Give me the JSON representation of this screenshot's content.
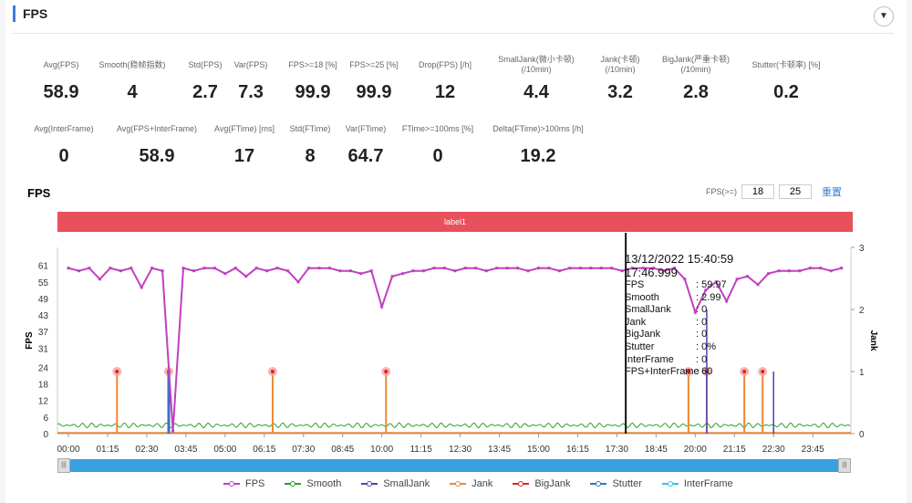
{
  "header": {
    "title": "FPS",
    "collapse_icon": "chevron-down-icon"
  },
  "stats_row1": [
    {
      "label": "Avg(FPS)",
      "value": "58.9",
      "help": false
    },
    {
      "label": "Smooth(稳帧指数)",
      "value": "4",
      "help": true
    },
    {
      "label": "Std(FPS)",
      "value": "2.7",
      "help": false
    },
    {
      "label": "Var(FPS)",
      "value": "7.3",
      "help": false
    },
    {
      "label": "FPS>=18 [%]",
      "value": "99.9",
      "help": false
    },
    {
      "label": "FPS>=25 [%]",
      "value": "99.9",
      "help": false
    },
    {
      "label": "Drop(FPS) [/h]",
      "value": "12",
      "help": true
    },
    {
      "label": "SmallJank(微小卡顿)",
      "label2": "(/10min)",
      "value": "4.4",
      "help": true
    },
    {
      "label": "Jank(卡顿)",
      "label2": "(/10min)",
      "value": "3.2",
      "help": true
    },
    {
      "label": "BigJank(严重卡顿)",
      "label2": "(/10min)",
      "value": "2.8",
      "help": true
    },
    {
      "label": "Stutter(卡顿率) [%]",
      "value": "0.2",
      "help": false
    }
  ],
  "stats_row2": [
    {
      "label": "Avg(InterFrame)",
      "value": "0",
      "help": false
    },
    {
      "label": "Avg(FPS+InterFrame)",
      "value": "58.9",
      "help": false
    },
    {
      "label": "Avg(FTime) [ms]",
      "value": "17",
      "help": false
    },
    {
      "label": "Std(FTime)",
      "value": "8",
      "help": false
    },
    {
      "label": "Var(FTime)",
      "value": "64.7",
      "help": false
    },
    {
      "label": "FTime>=100ms [%]",
      "value": "0",
      "help": false
    },
    {
      "label": "Delta(FTime)>100ms [/h]",
      "value": "19.2",
      "help": true
    }
  ],
  "chart_section": {
    "title": "FPS",
    "filter_label": "FPS(>=)",
    "filter_values": [
      "18",
      "25"
    ],
    "reset_label": "重置",
    "label_bar": "label1"
  },
  "tooltip": {
    "timestamp": "13/12/2022 15:40:59",
    "time": "17:46.999",
    "rows": [
      [
        "FPS",
        ": 59.97"
      ],
      [
        "Smooth",
        ": 2.99"
      ],
      [
        "SmallJank",
        ": 0"
      ],
      [
        "Jank",
        ": 0"
      ],
      [
        "BigJank",
        ": 0"
      ],
      [
        "Stutter",
        ": 0%"
      ],
      [
        "InterFrame",
        ": 0"
      ],
      [
        "FPS+InterFrame",
        ": 60"
      ]
    ]
  },
  "chart_data": {
    "type": "line",
    "xlabel": "",
    "ylabel": "FPS",
    "y2label": "Jank",
    "x_ticks": [
      "00:00",
      "01:15",
      "02:30",
      "03:45",
      "05:00",
      "06:15",
      "07:30",
      "08:45",
      "10:00",
      "11:15",
      "12:30",
      "13:45",
      "15:00",
      "16:15",
      "17:30",
      "18:45",
      "20:00",
      "21:15",
      "22:30",
      "23:45"
    ],
    "y_ticks": [
      0,
      6,
      12,
      18,
      24,
      31,
      37,
      43,
      49,
      55,
      61
    ],
    "y2_ticks": [
      0,
      1,
      2,
      3
    ],
    "ylim": [
      0,
      67.5
    ],
    "y2lim": [
      0,
      3
    ],
    "xlim_seconds": [
      -21,
      1498
    ],
    "fps_sample_interval_s": 20,
    "fps": [
      60,
      59,
      60,
      56,
      60,
      59,
      60,
      53,
      60,
      59,
      1,
      60,
      59,
      60,
      60,
      58,
      60,
      57,
      60,
      59,
      60,
      59,
      55,
      60,
      60,
      60,
      59,
      59,
      58,
      59,
      46,
      57,
      58,
      59,
      59,
      60,
      60,
      59,
      60,
      60,
      59,
      60,
      60,
      60,
      59,
      60,
      60,
      59,
      60,
      60,
      60,
      60,
      60,
      59,
      60,
      60,
      60,
      59,
      60,
      56,
      44,
      52,
      55,
      48,
      56,
      57,
      54,
      58,
      59,
      59,
      59,
      60,
      60,
      59,
      60
    ],
    "smooth_level": 3,
    "jank_events_s": [
      93,
      192,
      391,
      608,
      1187,
      1222,
      1294,
      1329
    ],
    "jank_value": 1,
    "smalljank_events": [
      {
        "t": 1222,
        "v": 2
      },
      {
        "t": 1350,
        "v": 1
      }
    ],
    "stutter_events": [
      {
        "t": 192,
        "v": 1
      }
    ],
    "cursor_time_s": 1067,
    "series": [
      {
        "name": "FPS",
        "color": "#c040c0"
      },
      {
        "name": "Smooth",
        "color": "#2ca02c"
      },
      {
        "name": "SmallJank",
        "color": "#4b45b5"
      },
      {
        "name": "Jank",
        "color": "#ee8833"
      },
      {
        "name": "BigJank",
        "color": "#d62728"
      },
      {
        "name": "Stutter",
        "color": "#3b6fc9"
      },
      {
        "name": "InterFrame",
        "color": "#2ec4e6"
      }
    ]
  }
}
